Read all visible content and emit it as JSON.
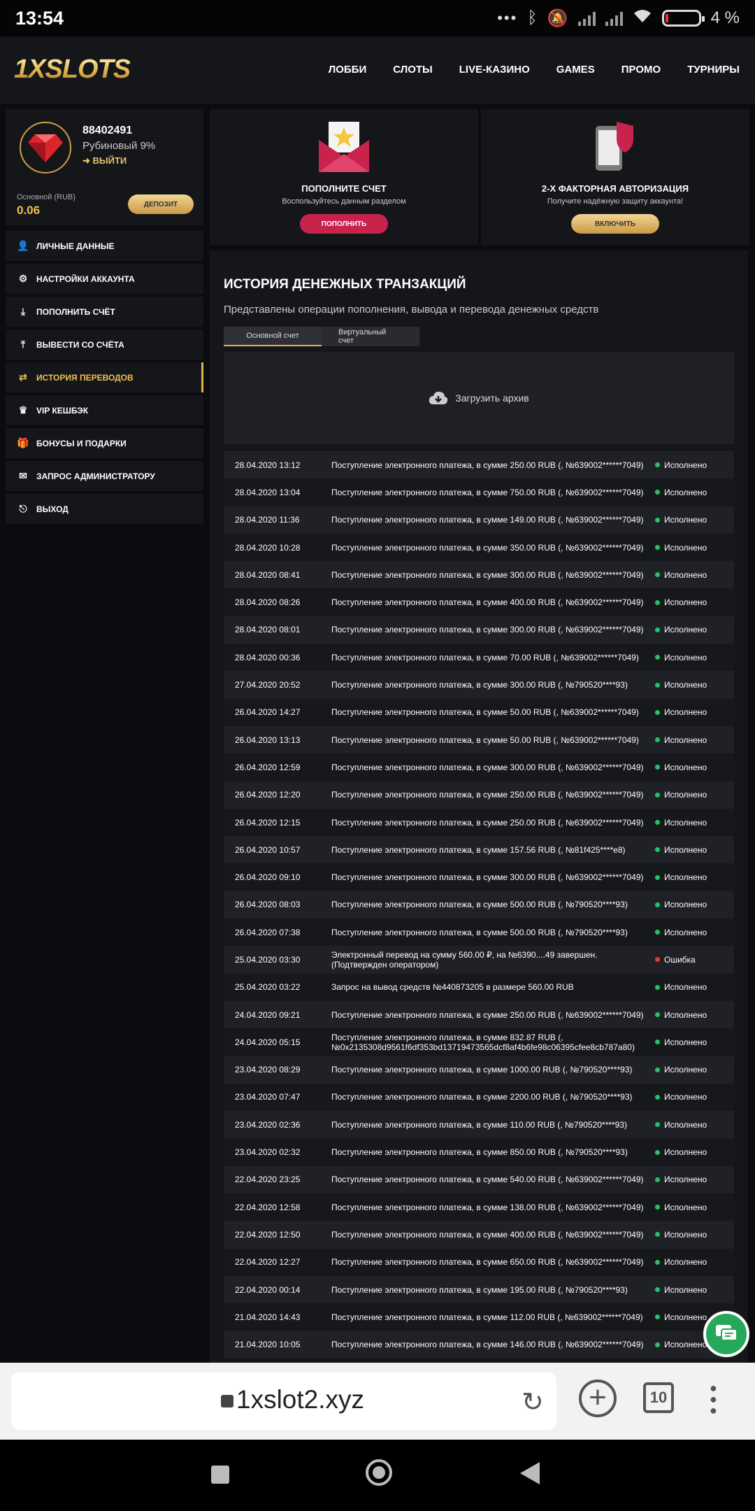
{
  "statusbar": {
    "time": "13:54",
    "battery": "4 %"
  },
  "header": {
    "logo": "1XSLOTS",
    "nav": [
      "ЛОББИ",
      "СЛОТЫ",
      "LIVE-КАЗИНО",
      "GAMES",
      "ПРОМО",
      "ТУРНИРЫ"
    ]
  },
  "profile": {
    "id": "88402491",
    "rank": "Рубиновый 9%",
    "logout": "ВЫЙТИ",
    "balance_label": "Основной (RUB)",
    "balance": "0.06",
    "deposit_button": "ДЕПОЗИТ"
  },
  "menu": [
    {
      "label": "ЛИЧНЫЕ ДАННЫЕ",
      "icon": "user-plus-icon",
      "active": false
    },
    {
      "label": "НАСТРОЙКИ АККАУНТА",
      "icon": "gears-icon",
      "active": false
    },
    {
      "label": "ПОПОЛНИТЬ СЧЁТ",
      "icon": "download-icon",
      "active": false
    },
    {
      "label": "ВЫВЕСТИ СО СЧЁТА",
      "icon": "upload-icon",
      "active": false
    },
    {
      "label": "ИСТОРИЯ ПЕРЕВОДОВ",
      "icon": "transfer-arrows-icon",
      "active": true
    },
    {
      "label": "VIP КЕШБЭК",
      "icon": "crown-icon",
      "active": false
    },
    {
      "label": "БОНУСЫ И ПОДАРКИ",
      "icon": "gift-icon",
      "active": false
    },
    {
      "label": "ЗАПРОС АДМИНИСТРАТОРУ",
      "icon": "envelope-icon",
      "active": false
    },
    {
      "label": "ВЫХОД",
      "icon": "exit-icon",
      "active": false
    }
  ],
  "cards": {
    "deposit": {
      "title": "ПОПОЛНИТЕ СЧЕТ",
      "subtitle": "Воспользуйтесь данным разделом",
      "button": "ПОПОЛНИТЬ",
      "color": "#c8234d"
    },
    "twofa": {
      "title": "2-Х ФАКТОРНАЯ АВТОРИЗАЦИЯ",
      "subtitle": "Получите надёжную защиту аккаунта!",
      "button": "ВКЛЮЧИТЬ",
      "color": "#e3bd6b"
    }
  },
  "history": {
    "title": "ИСТОРИЯ ДЕНЕЖНЫХ ТРАНЗАКЦИЙ",
    "description": "Представлены операции пополнения, вывода и перевода денежных средств",
    "tabs": [
      "Основной счет",
      "Виртуальный счет"
    ],
    "archive": "Загрузить архив",
    "rows": [
      {
        "date": "28.04.2020 13:12",
        "text": "Поступление электронного платежа, в сумме 250.00 RUB (, №639002******7049)",
        "status": "Исполнено",
        "ok": true
      },
      {
        "date": "28.04.2020 13:04",
        "text": "Поступление электронного платежа, в сумме 750.00 RUB (, №639002******7049)",
        "status": "Исполнено",
        "ok": true
      },
      {
        "date": "28.04.2020 11:36",
        "text": "Поступление электронного платежа, в сумме 149.00 RUB (, №639002******7049)",
        "status": "Исполнено",
        "ok": true
      },
      {
        "date": "28.04.2020 10:28",
        "text": "Поступление электронного платежа, в сумме 350.00 RUB (, №639002******7049)",
        "status": "Исполнено",
        "ok": true
      },
      {
        "date": "28.04.2020 08:41",
        "text": "Поступление электронного платежа, в сумме 300.00 RUB (, №639002******7049)",
        "status": "Исполнено",
        "ok": true
      },
      {
        "date": "28.04.2020 08:26",
        "text": "Поступление электронного платежа, в сумме 400.00 RUB (, №639002******7049)",
        "status": "Исполнено",
        "ok": true
      },
      {
        "date": "28.04.2020 08:01",
        "text": "Поступление электронного платежа, в сумме 300.00 RUB (, №639002******7049)",
        "status": "Исполнено",
        "ok": true
      },
      {
        "date": "28.04.2020 00:36",
        "text": "Поступление электронного платежа, в сумме 70.00 RUB (, №639002******7049)",
        "status": "Исполнено",
        "ok": true
      },
      {
        "date": "27.04.2020 20:52",
        "text": "Поступление электронного платежа, в сумме 300.00 RUB (, №790520****93)",
        "status": "Исполнено",
        "ok": true
      },
      {
        "date": "26.04.2020 14:27",
        "text": "Поступление электронного платежа, в сумме 50.00 RUB (, №639002******7049)",
        "status": "Исполнено",
        "ok": true
      },
      {
        "date": "26.04.2020 13:13",
        "text": "Поступление электронного платежа, в сумме 50.00 RUB (, №639002******7049)",
        "status": "Исполнено",
        "ok": true
      },
      {
        "date": "26.04.2020 12:59",
        "text": "Поступление электронного платежа, в сумме 300.00 RUB (, №639002******7049)",
        "status": "Исполнено",
        "ok": true
      },
      {
        "date": "26.04.2020 12:20",
        "text": "Поступление электронного платежа, в сумме 250.00 RUB (, №639002******7049)",
        "status": "Исполнено",
        "ok": true
      },
      {
        "date": "26.04.2020 12:15",
        "text": "Поступление электронного платежа, в сумме 250.00 RUB (, №639002******7049)",
        "status": "Исполнено",
        "ok": true
      },
      {
        "date": "26.04.2020 10:57",
        "text": "Поступление электронного платежа, в сумме 157.56 RUB (, №81f425****e8)",
        "status": "Исполнено",
        "ok": true
      },
      {
        "date": "26.04.2020 09:10",
        "text": "Поступление электронного платежа, в сумме 300.00 RUB (, №639002******7049)",
        "status": "Исполнено",
        "ok": true
      },
      {
        "date": "26.04.2020 08:03",
        "text": "Поступление электронного платежа, в сумме 500.00 RUB (, №790520****93)",
        "status": "Исполнено",
        "ok": true
      },
      {
        "date": "26.04.2020 07:38",
        "text": "Поступление электронного платежа, в сумме 500.00 RUB (, №790520****93)",
        "status": "Исполнено",
        "ok": true
      },
      {
        "date": "25.04.2020 03:30",
        "text": "Электронный перевод на сумму 560.00 ₽, на №6390....49 завершен. (Подтвержден оператором)",
        "status": "Ошибка",
        "ok": false
      },
      {
        "date": "25.04.2020 03:22",
        "text": "Запрос на вывод средств №440873205 в размере 560.00 RUB",
        "status": "Исполнено",
        "ok": true
      },
      {
        "date": "24.04.2020 09:21",
        "text": "Поступление электронного платежа, в сумме 250.00 RUB (, №639002******7049)",
        "status": "Исполнено",
        "ok": true
      },
      {
        "date": "24.04.2020 05:15",
        "text": "Поступление электронного платежа, в сумме 832.87 RUB (, №0x2135308d9561f6df353bd13719473565dcf8af4b6fe98c06395cfee8cb787a80)",
        "status": "Исполнено",
        "ok": true
      },
      {
        "date": "23.04.2020 08:29",
        "text": "Поступление электронного платежа, в сумме 1000.00 RUB (, №790520****93)",
        "status": "Исполнено",
        "ok": true
      },
      {
        "date": "23.04.2020 07:47",
        "text": "Поступление электронного платежа, в сумме 2200.00 RUB (, №790520****93)",
        "status": "Исполнено",
        "ok": true
      },
      {
        "date": "23.04.2020 02:36",
        "text": "Поступление электронного платежа, в сумме 110.00 RUB (, №790520****93)",
        "status": "Исполнено",
        "ok": true
      },
      {
        "date": "23.04.2020 02:32",
        "text": "Поступление электронного платежа, в сумме 850.00 RUB (, №790520****93)",
        "status": "Исполнено",
        "ok": true
      },
      {
        "date": "22.04.2020 23:25",
        "text": "Поступление электронного платежа, в сумме 540.00 RUB (, №639002******7049)",
        "status": "Исполнено",
        "ok": true
      },
      {
        "date": "22.04.2020 12:58",
        "text": "Поступление электронного платежа, в сумме 138.00 RUB (, №639002******7049)",
        "status": "Исполнено",
        "ok": true
      },
      {
        "date": "22.04.2020 12:50",
        "text": "Поступление электронного платежа, в сумме 400.00 RUB (, №639002******7049)",
        "status": "Исполнено",
        "ok": true
      },
      {
        "date": "22.04.2020 12:27",
        "text": "Поступление электронного платежа, в сумме 650.00 RUB (, №639002******7049)",
        "status": "Исполнено",
        "ok": true
      },
      {
        "date": "22.04.2020 00:14",
        "text": "Поступление электронного платежа, в сумме 195.00 RUB (, №790520****93)",
        "status": "Исполнено",
        "ok": true
      },
      {
        "date": "21.04.2020 14:43",
        "text": "Поступление электронного платежа, в сумме 112.00 RUB (, №639002******7049)",
        "status": "Исполнено",
        "ok": true
      },
      {
        "date": "21.04.2020 10:05",
        "text": "Поступление электронного платежа, в сумме 146.00 RUB (, №639002******7049)",
        "status": "Исполнено",
        "ok": true
      }
    ]
  },
  "browser": {
    "url": "1xslot2.xyz",
    "tab_count": "10"
  }
}
